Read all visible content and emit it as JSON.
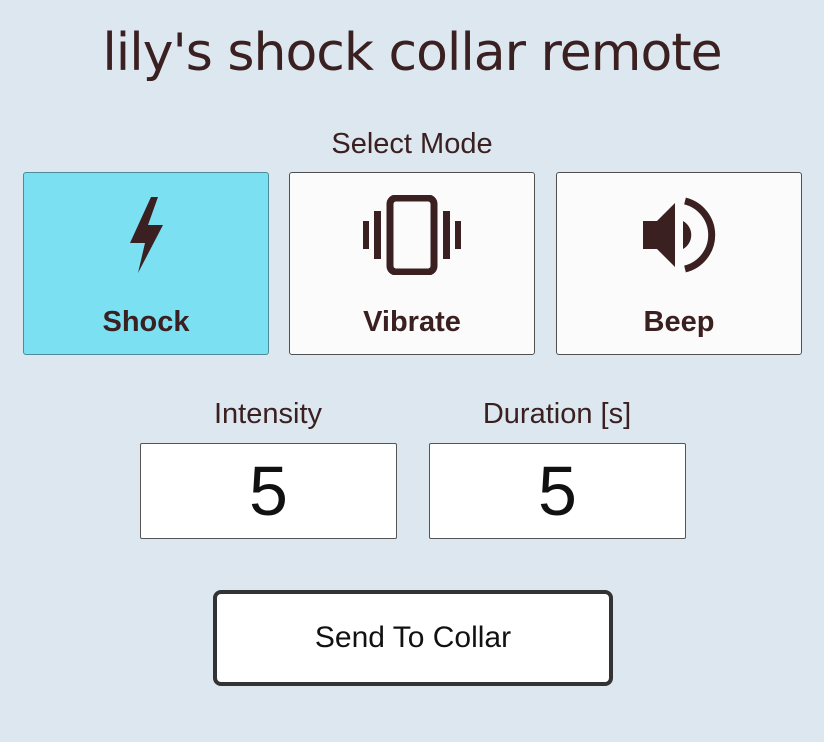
{
  "title": "lily's shock collar remote",
  "mode_select": {
    "label": "Select Mode",
    "selected": "Shock",
    "modes": [
      {
        "label": "Shock",
        "icon": "lightning-bolt-icon"
      },
      {
        "label": "Vibrate",
        "icon": "vibrate-phone-icon"
      },
      {
        "label": "Beep",
        "icon": "speaker-icon"
      }
    ]
  },
  "intensity": {
    "label": "Intensity",
    "value": "5"
  },
  "duration": {
    "label": "Duration [s]",
    "value": "5"
  },
  "send_button": {
    "label": "Send To Collar"
  },
  "colors": {
    "background": "#dde7ef",
    "active_mode": "#7be0f2",
    "text": "#3a2020"
  }
}
